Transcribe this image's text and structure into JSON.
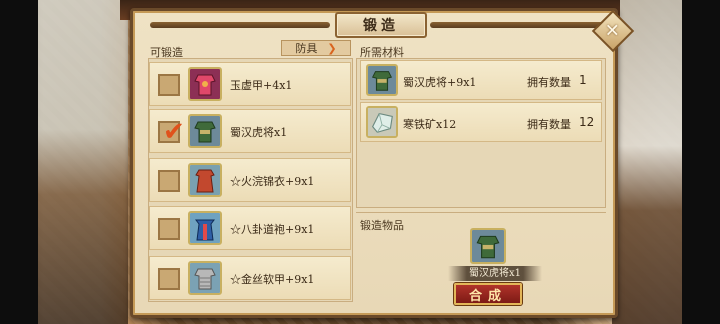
{
  "window": {
    "title": "锻造"
  },
  "left": {
    "label": "可锻造",
    "filter": {
      "value": "防具",
      "chevron_icon": "chevron-down-icon"
    },
    "items": [
      {
        "name": "玉虚甲+4x1",
        "checked": false,
        "icon": "armor-icon",
        "icon_color": "#c9384e"
      },
      {
        "name": "蜀汉虎将x1",
        "checked": true,
        "icon": "armor-icon",
        "icon_color": "#3f6a3a"
      },
      {
        "name": "☆火浣锦衣+9x1",
        "checked": false,
        "icon": "robe-icon",
        "icon_color": "#c2482e"
      },
      {
        "name": "☆八卦道袍+9x1",
        "checked": false,
        "icon": "robe-icon",
        "icon_color": "#2f5fa6"
      },
      {
        "name": "☆金丝软甲+9x1",
        "checked": false,
        "icon": "armor-icon",
        "icon_color": "#9a9a9a"
      }
    ]
  },
  "materials": {
    "label": "所需材料",
    "own_label": "拥有数量",
    "rows": [
      {
        "name": "蜀汉虎将+9x1",
        "count": "1",
        "icon": "armor-icon",
        "icon_color": "#3f6a3a"
      },
      {
        "name": "寒铁矿x12",
        "count": "12",
        "icon": "ore-icon",
        "icon_color": "#9fb8ae"
      }
    ]
  },
  "result": {
    "label": "锻造物品",
    "name": "蜀汉虎将x1",
    "icon": "armor-icon",
    "icon_color": "#3f6a3a",
    "button_label": "合成"
  },
  "colors": {
    "accent": "#e0521c",
    "button": "#9a2620",
    "panel": "#ecdcb6"
  }
}
